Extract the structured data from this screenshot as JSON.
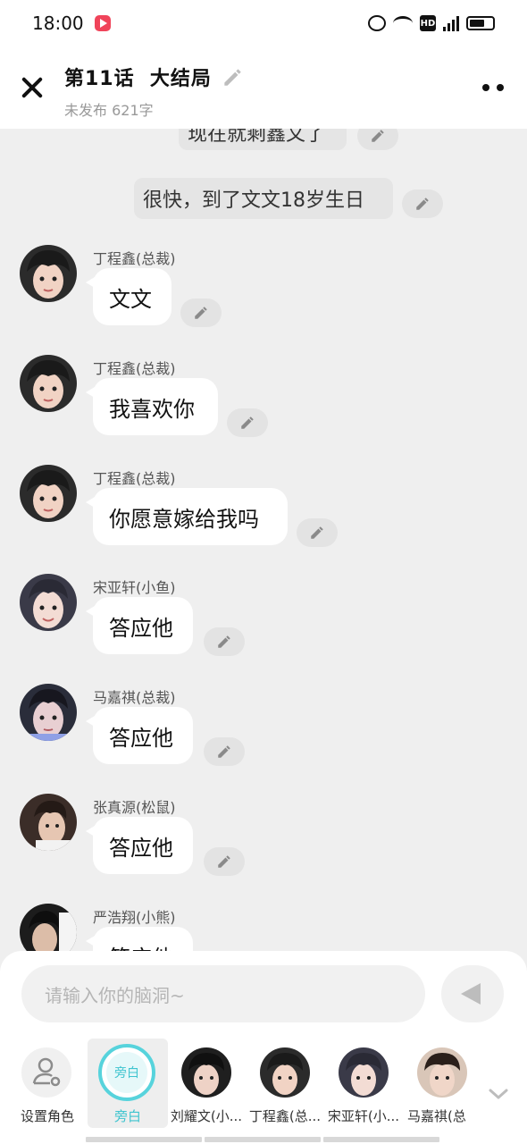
{
  "status": {
    "time": "18:00",
    "hd": "HD",
    "network": "4G"
  },
  "header": {
    "title": "第11话  大结局",
    "subtitle": "未发布 621字"
  },
  "narrations": [
    {
      "text": "现在就剩鑫文了"
    },
    {
      "text": "很快，到了文文18岁生日"
    }
  ],
  "messages": [
    {
      "speaker": "丁程鑫(总裁)",
      "text": "文文"
    },
    {
      "speaker": "丁程鑫(总裁)",
      "text": "我喜欢你"
    },
    {
      "speaker": "丁程鑫(总裁)",
      "text": "你愿意嫁给我吗"
    },
    {
      "speaker": "宋亚轩(小鱼)",
      "text": "答应他"
    },
    {
      "speaker": "马嘉祺(总裁)",
      "text": "答应他"
    },
    {
      "speaker": "张真源(松鼠)",
      "text": "答应他"
    },
    {
      "speaker": "严浩翔(小熊)",
      "text": "答应他"
    }
  ],
  "input": {
    "placeholder": "请输入你的脑洞~"
  },
  "roles": [
    {
      "label": "设置角色"
    },
    {
      "label": "旁白",
      "inner": "旁白"
    },
    {
      "label": "刘耀文(小..."
    },
    {
      "label": "丁程鑫(总..."
    },
    {
      "label": "宋亚轩(小..."
    },
    {
      "label": "马嘉祺(总"
    }
  ],
  "colors": {
    "accent": "#57d3dc",
    "background": "#efefef",
    "bubble": "#ffffff"
  }
}
